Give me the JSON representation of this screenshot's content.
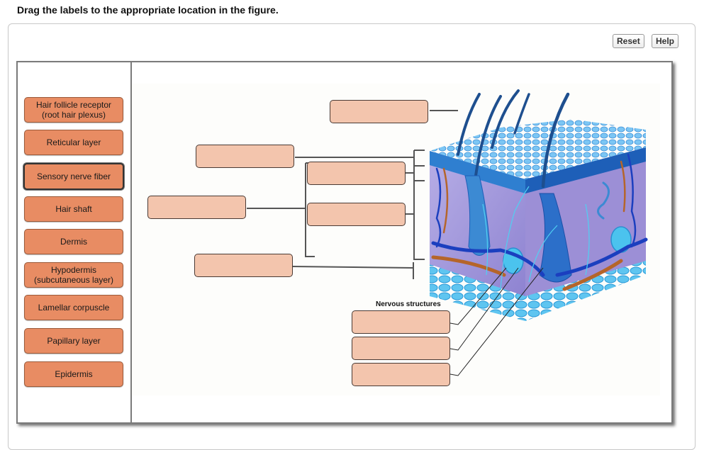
{
  "instruction": "Drag the labels to the appropriate location in the figure.",
  "toolbar": {
    "reset_label": "Reset",
    "help_label": "Help"
  },
  "label_bank": {
    "labels": [
      {
        "text": "Hair follicle receptor\n(root hair plexus)",
        "line1": "Hair follicle receptor",
        "line2": "(root hair plexus)",
        "selected": false
      },
      {
        "text": "Reticular layer",
        "line1": "Reticular layer",
        "line2": "",
        "selected": false
      },
      {
        "text": "Sensory nerve fiber",
        "line1": "Sensory nerve fiber",
        "line2": "",
        "selected": true
      },
      {
        "text": "Hair shaft",
        "line1": "Hair shaft",
        "line2": "",
        "selected": false
      },
      {
        "text": "Dermis",
        "line1": "Dermis",
        "line2": "",
        "selected": false
      },
      {
        "text": "Hypodermis\n(subcutaneous layer)",
        "line1": "Hypodermis",
        "line2": "(subcutaneous layer)",
        "selected": false
      },
      {
        "text": "Lamellar corpuscle",
        "line1": "Lamellar corpuscle",
        "line2": "",
        "selected": false
      },
      {
        "text": "Papillary layer",
        "line1": "Papillary layer",
        "line2": "",
        "selected": false
      },
      {
        "text": "Epidermis",
        "line1": "Epidermis",
        "line2": "",
        "selected": false
      }
    ]
  },
  "figure": {
    "drop_zones": [
      {
        "id": "hair-target",
        "value": ""
      },
      {
        "id": "upper-left-target",
        "value": ""
      },
      {
        "id": "inner-upper-target",
        "value": ""
      },
      {
        "id": "far-left-target",
        "value": ""
      },
      {
        "id": "inner-lower-target",
        "value": ""
      },
      {
        "id": "lower-left-target",
        "value": ""
      },
      {
        "id": "nervous-target-1",
        "value": ""
      },
      {
        "id": "nervous-target-2",
        "value": ""
      },
      {
        "id": "nervous-target-3",
        "value": ""
      }
    ],
    "group_title": "Nervous structures",
    "illustration": "skin cross-section with hair follicles, nerves, vessels and corpuscles",
    "colors": {
      "label_tile": "#e88c63",
      "drop_zone": "#f3c5ad",
      "skin_blue": "#2f7fd0",
      "dermis_purple": "#a79ad8",
      "vessel_brown": "#b5652a",
      "vessel_blue": "#1b3fbf"
    }
  }
}
